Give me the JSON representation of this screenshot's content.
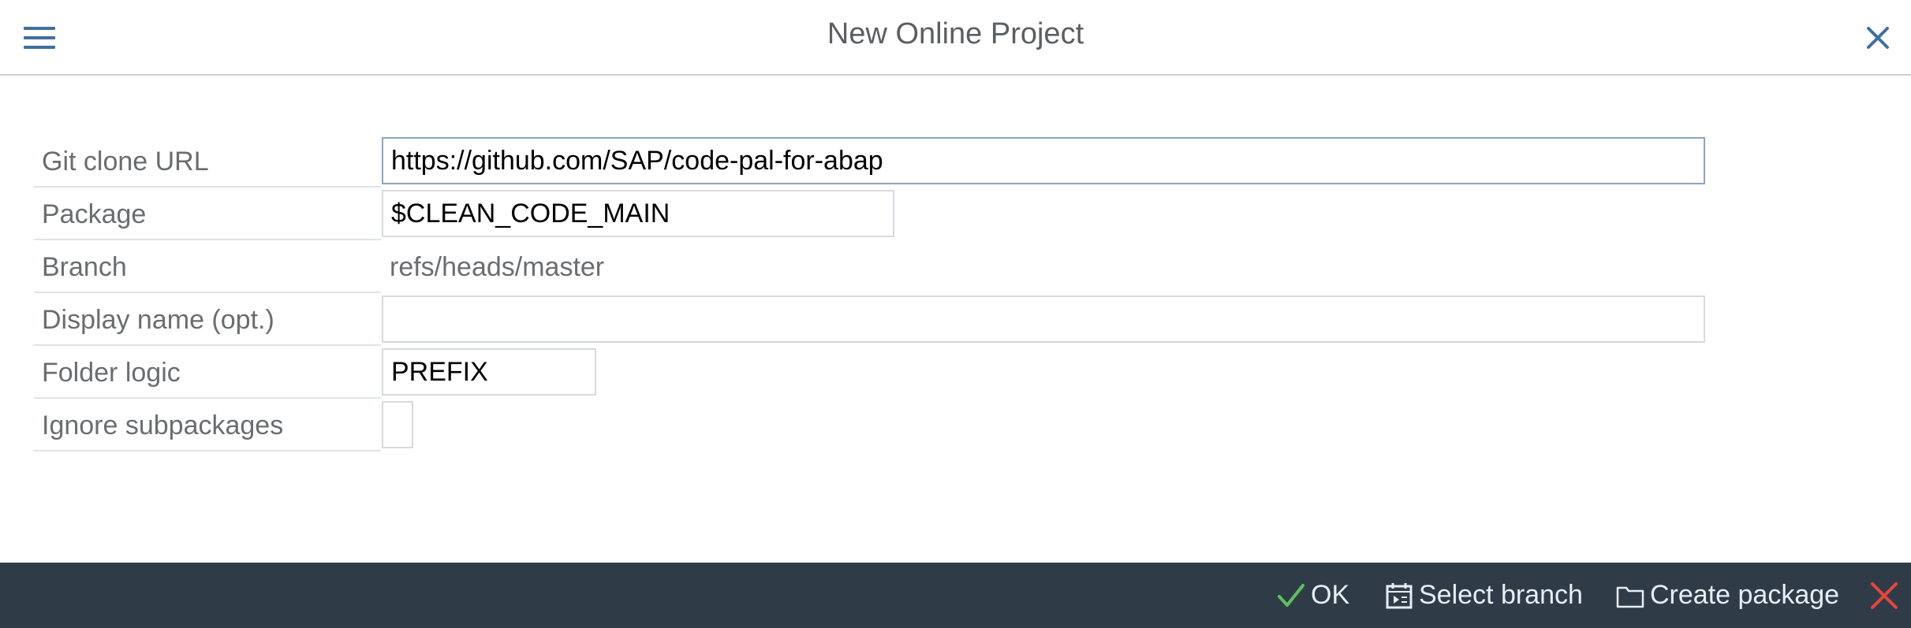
{
  "header": {
    "title": "New Online Project",
    "menu_icon": "menu-icon",
    "close_icon": "close-icon"
  },
  "form": {
    "git_url": {
      "label": "Git clone URL",
      "value": "https://github.com/SAP/code-pal-for-abap"
    },
    "package": {
      "label": "Package",
      "value": "$CLEAN_CODE_MAIN"
    },
    "branch": {
      "label": "Branch",
      "value": "refs/heads/master"
    },
    "display_name": {
      "label": "Display name (opt.)",
      "value": ""
    },
    "folder_logic": {
      "label": "Folder logic",
      "value": "PREFIX"
    },
    "ignore_subpackages": {
      "label": "Ignore subpackages",
      "checked": false
    }
  },
  "footer": {
    "ok_label": "OK",
    "select_branch_label": "Select branch",
    "create_package_label": "Create package"
  },
  "colors": {
    "footer_bg": "#2f3c48",
    "ok_icon": "#5ec15e",
    "cancel_icon": "#e8453c",
    "accent": "#3f6fa0"
  }
}
